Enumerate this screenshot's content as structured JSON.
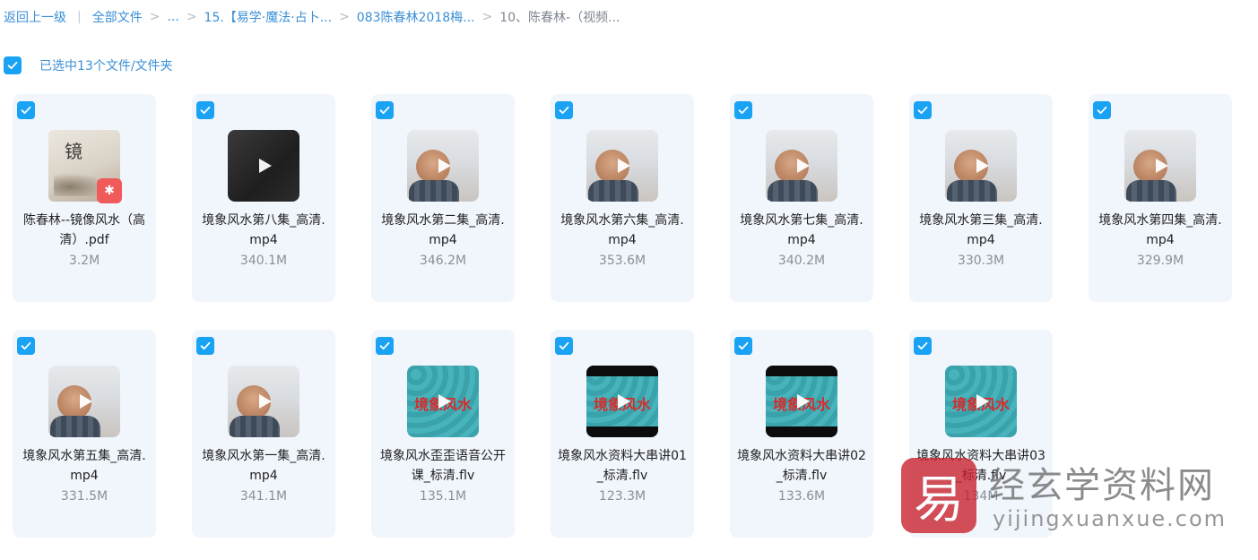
{
  "breadcrumb": {
    "back": "返回上一级",
    "all": "全部文件",
    "ellipsis": "...",
    "c1": "15.【易学·魔法·占卜...",
    "c2": "083陈春林2018梅...",
    "current": "10、陈春林-（视频..."
  },
  "selection": {
    "text": "已选中13个文件/文件夹"
  },
  "colors": {
    "accent": "#1aa2f4",
    "card_bg": "#f1f6fd",
    "link": "#3a8fd6"
  },
  "files": [
    {
      "name": "陈春林--镜像风水（高清）.pdf",
      "size": "3.2M",
      "thumb": "pdf-cover",
      "badge": "pdf-icon"
    },
    {
      "name": "境象风水第八集_高清.mp4",
      "size": "340.1M",
      "thumb": "video-dark"
    },
    {
      "name": "境象风水第二集_高清.mp4",
      "size": "346.2M",
      "thumb": "video-board"
    },
    {
      "name": "境象风水第六集_高清.mp4",
      "size": "353.6M",
      "thumb": "video-board"
    },
    {
      "name": "境象风水第七集_高清.mp4",
      "size": "340.2M",
      "thumb": "video-board"
    },
    {
      "name": "境象风水第三集_高清.mp4",
      "size": "330.3M",
      "thumb": "video-board"
    },
    {
      "name": "境象风水第四集_高清.mp4",
      "size": "329.9M",
      "thumb": "video-board"
    },
    {
      "name": "境象风水第五集_高清.mp4",
      "size": "331.5M",
      "thumb": "video-board"
    },
    {
      "name": "境象风水第一集_高清.mp4",
      "size": "341.1M",
      "thumb": "video-board"
    },
    {
      "name": "境象风水歪歪语音公开课_标清.flv",
      "size": "135.1M",
      "thumb": "video-teal",
      "thumb_title": "境象风水"
    },
    {
      "name": "境象风水资料大串讲01_标清.flv",
      "size": "123.3M",
      "thumb": "video-teal-bar",
      "thumb_title": "境象风水"
    },
    {
      "name": "境象风水资料大串讲02_标清.flv",
      "size": "133.6M",
      "thumb": "video-teal-bar",
      "thumb_title": "境象风水"
    },
    {
      "name": "境象风水资料大串讲03_标清.flv",
      "size": "134M",
      "thumb": "video-teal",
      "thumb_title": "境象风水"
    }
  ],
  "watermark": {
    "logo_char": "易",
    "cn": "经玄学资料网",
    "en": "yijingxuanxue.com"
  }
}
